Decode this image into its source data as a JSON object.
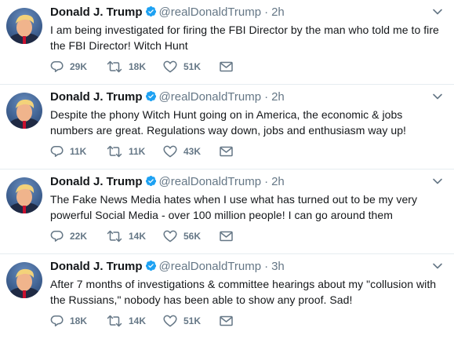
{
  "tweets": [
    {
      "name": "Donald J. Trump",
      "handle": "@realDonaldTrump",
      "separator": "·",
      "time": "2h",
      "text": "I am being investigated for firing the FBI Director by the man who told me to fire the FBI Director! Witch Hunt",
      "replies": "29K",
      "retweets": "18K",
      "likes": "51K"
    },
    {
      "name": "Donald J. Trump",
      "handle": "@realDonaldTrump",
      "separator": "·",
      "time": "2h",
      "text": "Despite the phony Witch Hunt going on in America, the economic & jobs numbers are great. Regulations way down, jobs and enthusiasm way up!",
      "replies": "11K",
      "retweets": "11K",
      "likes": "43K"
    },
    {
      "name": "Donald J. Trump",
      "handle": "@realDonaldTrump",
      "separator": "·",
      "time": "2h",
      "text": "The Fake News Media hates when I use what has turned out to be my very powerful Social Media - over 100 million people! I can go around them",
      "replies": "22K",
      "retweets": "14K",
      "likes": "56K"
    },
    {
      "name": "Donald J. Trump",
      "handle": "@realDonaldTrump",
      "separator": "·",
      "time": "3h",
      "text": "After 7 months of investigations & committee hearings about my \"collusion with the Russians,\"  nobody has been able to show any proof. Sad!",
      "replies": "18K",
      "retweets": "14K",
      "likes": "51K"
    }
  ],
  "icons": {
    "reply": "reply-icon",
    "retweet": "retweet-icon",
    "like": "heart-icon",
    "dm": "envelope-icon",
    "verified": "verified-badge-icon",
    "caret": "chevron-down-icon"
  },
  "colors": {
    "text": "#14171a",
    "secondary": "#657786",
    "verified": "#1da1f2",
    "divider": "#e6ecf0"
  }
}
